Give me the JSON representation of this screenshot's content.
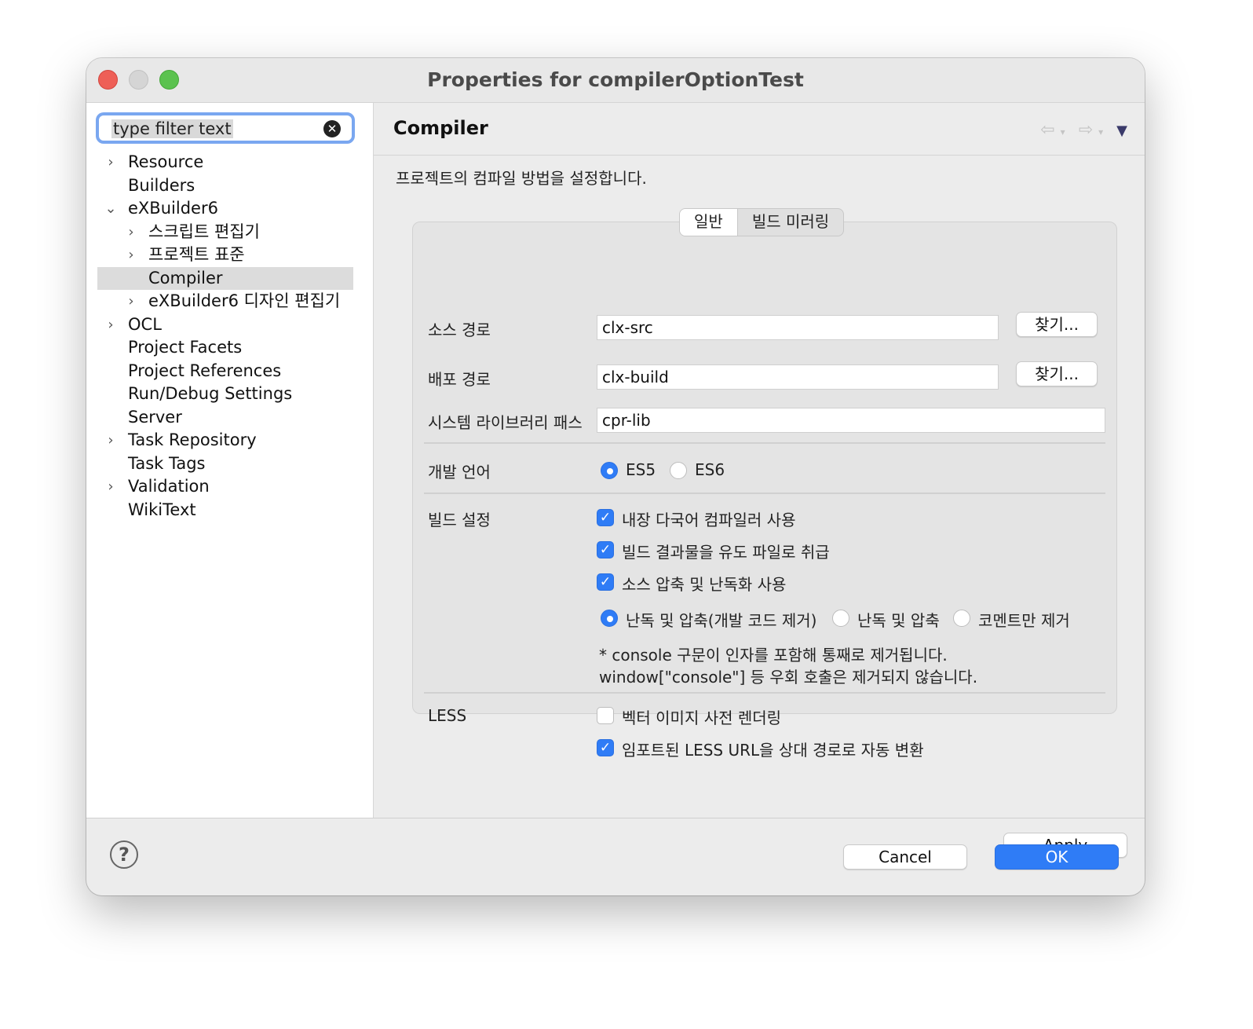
{
  "window": {
    "title": "Properties for compilerOptionTest"
  },
  "sidebar": {
    "filter": {
      "text": "type filter text"
    },
    "items": [
      {
        "label": "Resource",
        "chevron": "›"
      },
      {
        "label": "Builders",
        "chevron": ""
      },
      {
        "label": "eXBuilder6",
        "chevron": "⌄"
      },
      {
        "label": "스크립트 편집기",
        "chevron": "›"
      },
      {
        "label": "프로젝트 표준",
        "chevron": "›"
      },
      {
        "label": "Compiler",
        "chevron": ""
      },
      {
        "label": "eXBuilder6 디자인 편집기",
        "chevron": "›"
      },
      {
        "label": "OCL",
        "chevron": "›"
      },
      {
        "label": "Project Facets",
        "chevron": ""
      },
      {
        "label": "Project References",
        "chevron": ""
      },
      {
        "label": "Run/Debug Settings",
        "chevron": ""
      },
      {
        "label": "Server",
        "chevron": ""
      },
      {
        "label": "Task Repository",
        "chevron": "›"
      },
      {
        "label": "Task Tags",
        "chevron": ""
      },
      {
        "label": "Validation",
        "chevron": "›"
      },
      {
        "label": "WikiText",
        "chevron": ""
      }
    ]
  },
  "main": {
    "title": "Compiler",
    "nav": {
      "back": "⇦",
      "forward": "⇨",
      "dropdown": "▾",
      "menu": "▼"
    },
    "description": "프로젝트의 컴파일 방법을 설정합니다.",
    "tabs": [
      {
        "label": "일반"
      },
      {
        "label": "빌드 미러링"
      }
    ],
    "source_path": {
      "label": "소스 경로",
      "value": "clx-src",
      "browse": "찾기..."
    },
    "deploy_path": {
      "label": "배포 경로",
      "value": "clx-build",
      "browse": "찾기..."
    },
    "system_lib_path": {
      "label": "시스템 라이브러리 패스",
      "value": "cpr-lib"
    },
    "dev_language": {
      "label": "개발 언어",
      "options": [
        {
          "label": "ES5",
          "checked": true
        },
        {
          "label": "ES6",
          "checked": false
        }
      ]
    },
    "build": {
      "label": "빌드 설정",
      "checks": [
        {
          "label": "내장 다국어 컴파일러 사용",
          "checked": true
        },
        {
          "label": "빌드 결과물을 유도 파일로 취급",
          "checked": true
        },
        {
          "label": "소스 압축 및 난독화 사용",
          "checked": true
        }
      ],
      "obfuscation": [
        {
          "label": "난독 및 압축(개발 코드 제거)",
          "checked": true
        },
        {
          "label": "난독 및 압축",
          "checked": false
        },
        {
          "label": "코멘트만 제거",
          "checked": false
        }
      ],
      "note_line1": "* console 구문이 인자를 포함해 통째로 제거됩니다.",
      "note_line2": "window[\"console\"] 등 우회 호출은 제거되지 않습니다."
    },
    "less": {
      "label": "LESS",
      "checks": [
        {
          "label": "벡터 이미지 사전 렌더링",
          "checked": false
        },
        {
          "label": "임포트된 LESS URL을 상대 경로로 자동 변환",
          "checked": true
        }
      ]
    },
    "apply": "Apply"
  },
  "footer": {
    "help": "?",
    "cancel": "Cancel",
    "ok": "OK"
  }
}
